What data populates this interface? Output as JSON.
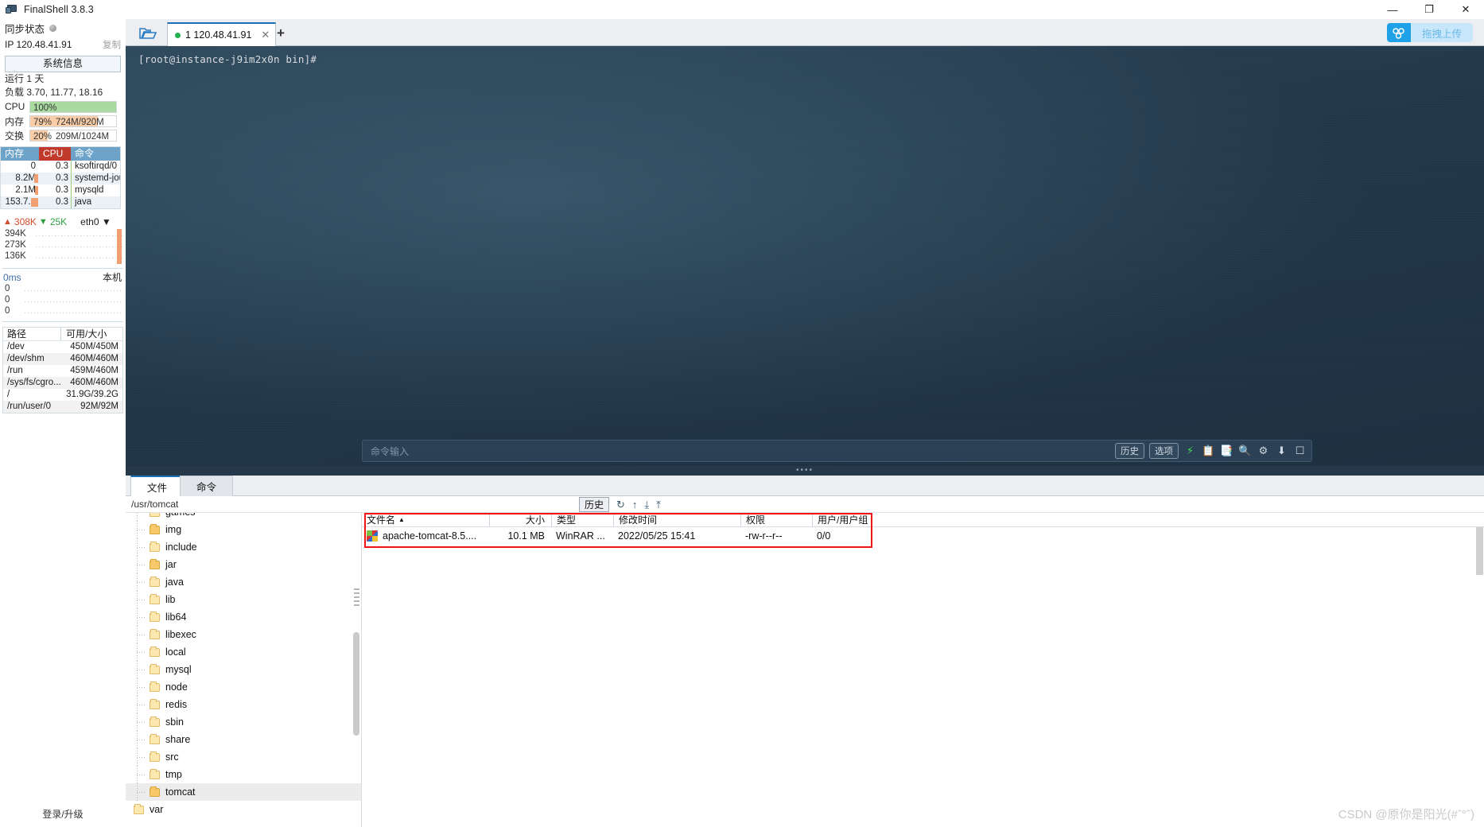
{
  "window": {
    "title": "FinalShell 3.8.3",
    "app_icon": "monitor-icon",
    "minimize": "—",
    "maximize": "❐",
    "close": "✕"
  },
  "sidebar": {
    "sync_label": "同步状态",
    "ip_label": "IP 120.48.41.91",
    "copy_label": "复制",
    "sysinfo_button": "系统信息",
    "uptime": "运行 1 天",
    "load": "负载 3.70, 11.77, 18.16",
    "meters": [
      {
        "name": "CPU",
        "label": "CPU",
        "pct": "100%",
        "detail": "",
        "fill_pct": 100,
        "color": "#a9dba0"
      },
      {
        "name": "内存",
        "label": "内存",
        "pct": "79%",
        "detail": "724M/920M",
        "fill_pct": 79,
        "color": "#f8cda8"
      },
      {
        "name": "交换",
        "label": "交换",
        "pct": "20%",
        "detail": "209M/1024M",
        "fill_pct": 20,
        "color": "#f8cda8"
      }
    ],
    "process_table": {
      "headers": [
        "内存",
        "CPU",
        "命令"
      ],
      "rows": [
        {
          "mem": "0",
          "cpu": "0.3",
          "cmd": "ksoftirqd/0",
          "mem_bar": 0
        },
        {
          "mem": "8.2M",
          "cpu": "0.3",
          "cmd": "systemd-jour...",
          "mem_bar": 6
        },
        {
          "mem": "2.1M",
          "cpu": "0.3",
          "cmd": "mysqld",
          "mem_bar": 4
        },
        {
          "mem": "153.7...",
          "cpu": "0.3",
          "cmd": "java",
          "mem_bar": 14
        }
      ]
    },
    "network": {
      "up": "308K",
      "down": "25K",
      "interface": "eth0",
      "graph_labels": [
        "394K",
        "273K",
        "136K"
      ]
    },
    "ping": {
      "latency": "0ms",
      "target": "本机",
      "graph_labels": [
        "0",
        "0",
        "0"
      ]
    },
    "disk_table": {
      "headers": [
        "路径",
        "可用/大小"
      ],
      "rows": [
        {
          "path": "/dev",
          "usage": "450M/450M"
        },
        {
          "path": "/dev/shm",
          "usage": "460M/460M"
        },
        {
          "path": "/run",
          "usage": "459M/460M"
        },
        {
          "path": "/sys/fs/cgro...",
          "usage": "460M/460M"
        },
        {
          "path": "/",
          "usage": "31.9G/39.2G"
        },
        {
          "path": "/run/user/0",
          "usage": "92M/92M"
        }
      ]
    },
    "login_upgrade": "登录/升级"
  },
  "tabbar": {
    "folder_icon": "open-folder-icon",
    "tab_label": "1 120.48.41.91",
    "tab_close": "✕",
    "add_tab": "+",
    "upload_label": "拖拽上传"
  },
  "terminal": {
    "prompt_line": "[root@instance-j9im2x0n bin]#",
    "command_placeholder": "命令输入",
    "history_button": "历史",
    "options_button": "选项",
    "tool_icons": [
      "bolt-icon",
      "paste-icon",
      "copy-icon",
      "search-icon",
      "gear-icon",
      "download-icon",
      "window-icon"
    ]
  },
  "bottom": {
    "tabs": [
      {
        "label": "文件",
        "active": true
      },
      {
        "label": "命令",
        "active": false
      }
    ],
    "path": "/usr/tomcat",
    "toolbar": {
      "history_button": "历史",
      "icons": [
        "refresh-icon",
        "upload-arrow-icon",
        "download-arrow-icon",
        "upload-file-icon"
      ]
    },
    "tree": [
      {
        "label": "games",
        "depth": 1,
        "selected": false,
        "deep": false
      },
      {
        "label": "img",
        "depth": 1,
        "selected": false,
        "deep": true
      },
      {
        "label": "include",
        "depth": 1,
        "selected": false,
        "deep": false
      },
      {
        "label": "jar",
        "depth": 1,
        "selected": false,
        "deep": true
      },
      {
        "label": "java",
        "depth": 1,
        "selected": false,
        "deep": false
      },
      {
        "label": "lib",
        "depth": 1,
        "selected": false,
        "deep": false
      },
      {
        "label": "lib64",
        "depth": 1,
        "selected": false,
        "deep": false
      },
      {
        "label": "libexec",
        "depth": 1,
        "selected": false,
        "deep": false
      },
      {
        "label": "local",
        "depth": 1,
        "selected": false,
        "deep": false
      },
      {
        "label": "mysql",
        "depth": 1,
        "selected": false,
        "deep": false
      },
      {
        "label": "node",
        "depth": 1,
        "selected": false,
        "deep": false
      },
      {
        "label": "redis",
        "depth": 1,
        "selected": false,
        "deep": false
      },
      {
        "label": "sbin",
        "depth": 1,
        "selected": false,
        "deep": false
      },
      {
        "label": "share",
        "depth": 1,
        "selected": false,
        "deep": false
      },
      {
        "label": "src",
        "depth": 1,
        "selected": false,
        "deep": false
      },
      {
        "label": "tmp",
        "depth": 1,
        "selected": false,
        "deep": false
      },
      {
        "label": "tomcat",
        "depth": 1,
        "selected": true,
        "deep": true
      },
      {
        "label": "var",
        "depth": 0,
        "selected": false,
        "deep": false
      }
    ],
    "file_headers": [
      "文件名",
      "大小",
      "类型",
      "修改时间",
      "权限",
      "用户/用户组"
    ],
    "sort_indicator": "▲",
    "files": [
      {
        "icon": "winrar-archive-icon",
        "name": "apache-tomcat-8.5....",
        "size": "10.1 MB",
        "type": "WinRAR ...",
        "modified": "2022/05/25 15:41",
        "permissions": "-rw-r--r--",
        "owner": "0/0"
      }
    ]
  },
  "watermark": "CSDN @原你是阳光(#ˆ°ˆ)"
}
